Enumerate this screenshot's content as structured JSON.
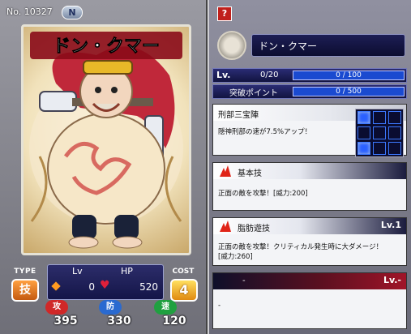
{
  "card": {
    "number_label": "No.",
    "number": "10327",
    "rarity": "N",
    "name_banner": "ドン・クマー",
    "type_label": "TYPE",
    "type_value": "技",
    "cost_label": "COST",
    "cost_value": "4",
    "lv_label": "Lv",
    "hp_label": "HP",
    "lv_value": "0",
    "hp_value": "520",
    "attack": {
      "label": "攻",
      "value": "395"
    },
    "defense": {
      "label": "防",
      "value": "330"
    },
    "speed": {
      "label": "速",
      "value": "120"
    }
  },
  "detail": {
    "help_icon": "?",
    "name": "ドン・クマー",
    "lv_label": "Lv.",
    "lv_progress": "0/20",
    "exp_progress": "0 / 100",
    "limit_label": "突破ポイント",
    "limit_progress": "0 / 500",
    "formation_skill": {
      "title": "刑部三宝陣",
      "description": "隠神刑部の速が7.5%アップ！"
    },
    "basic_skill": {
      "title": "基本技",
      "description": "正面の敵を攻撃！[威力:200]"
    },
    "special_skill": {
      "title": "脂肪遊技",
      "level": "Lv.1",
      "description": "正面の敵を攻撃！クリティカル発生時に大ダメージ！\n[威力:260]"
    },
    "extra_skill": {
      "title": "-",
      "level": "Lv.-",
      "description": "-"
    }
  },
  "colors": {
    "type_badge": "#e06a18",
    "cost_badge": "#f0a020",
    "attack": "#d02828",
    "defense": "#2a6ad0",
    "speed": "#20a040",
    "formation_active": "#2a60ff"
  },
  "formation_grid": [
    [
      true,
      false,
      false
    ],
    [
      false,
      false,
      false
    ],
    [
      true,
      false,
      false
    ]
  ]
}
